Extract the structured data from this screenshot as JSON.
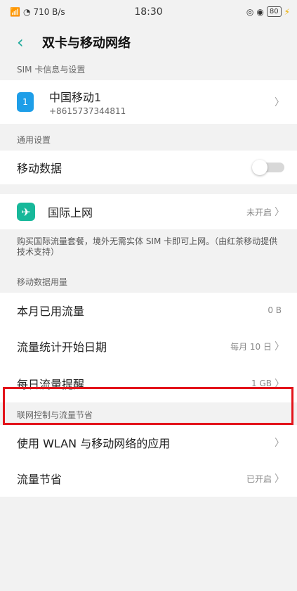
{
  "status_bar": {
    "signal_text": "46",
    "speed": "710 B/s",
    "time": "18:30",
    "battery": "80"
  },
  "nav": {
    "title": "双卡与移动网络"
  },
  "sim_section": {
    "header": "SIM 卡信息与设置",
    "sim_name": "中国移动1",
    "sim_number": "+8615737344811",
    "sim_badge": "1"
  },
  "general_section": {
    "header": "通用设置",
    "mobile_data_label": "移动数据",
    "mobile_data_on": false
  },
  "intl": {
    "label": "国际上网",
    "value": "未开启",
    "description": "购买国际流量套餐，境外无需实体 SIM 卡即可上网。（由红茶移动提供技术支持）"
  },
  "usage_section": {
    "header": "移动数据用量",
    "rows": [
      {
        "label": "本月已用流量",
        "value": "0 B"
      },
      {
        "label": "流量统计开始日期",
        "value": "每月 10 日"
      },
      {
        "label": "每日流量提醒",
        "value": "1 GB"
      }
    ]
  },
  "control_section": {
    "header": "联网控制与流量节省",
    "rows": [
      {
        "label": "使用 WLAN 与移动网络的应用",
        "value": ""
      },
      {
        "label": "流量节省",
        "value": "已开启"
      }
    ]
  },
  "colors": {
    "accent": "#1aa89a",
    "highlight": "#e3141b"
  }
}
